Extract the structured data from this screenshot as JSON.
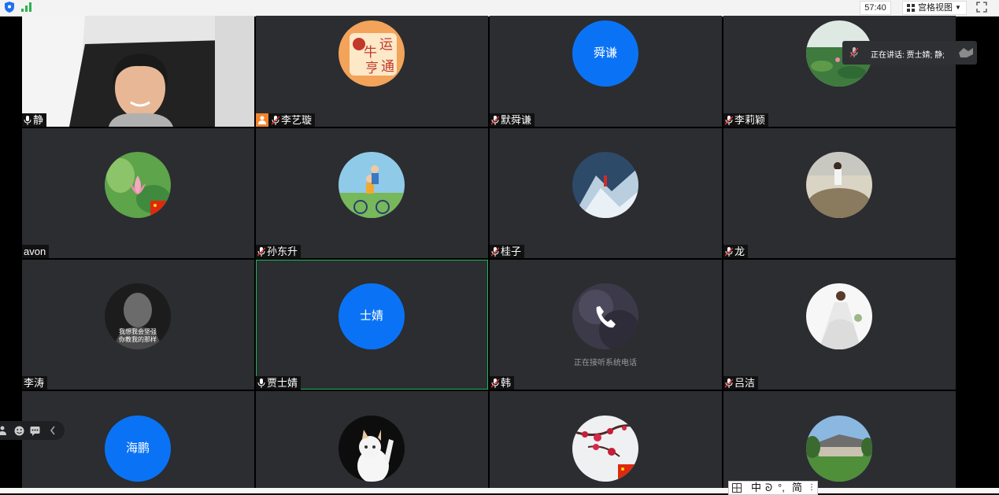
{
  "topbar": {
    "timer": "57:40",
    "view_label": "宫格视图"
  },
  "speaking": {
    "label": "正在讲话: 贾士婧; 静;"
  },
  "tiles": [
    {
      "name": "静"
    },
    {
      "name": "李艺璇",
      "avatar_text": [
        "牛",
        "运",
        "亨",
        "通"
      ]
    },
    {
      "name": "默舜谦",
      "avatar_text": "舜谦"
    },
    {
      "name": "李莉颖"
    },
    {
      "name": "avon"
    },
    {
      "name": "孙东升"
    },
    {
      "name": "桂子"
    },
    {
      "name": "龙"
    },
    {
      "name": "李涛",
      "avatar_text": [
        "我想我会坚强",
        "你教我的那样"
      ]
    },
    {
      "name": "贾士婧",
      "avatar_text": "士婧"
    },
    {
      "name": "韩",
      "status": "正在接听系统电话"
    },
    {
      "name": "吕洁"
    },
    {
      "avatar_text": "海鹏"
    },
    {},
    {},
    {}
  ],
  "ime": {
    "items": [
      "中",
      "ᘐ",
      "°,",
      "简"
    ]
  },
  "colors": {
    "tile_bg": "#2b2d31",
    "avatar_blue": "#0a73f5",
    "active_border": "#1db85a",
    "host_orange": "#f2842b"
  }
}
